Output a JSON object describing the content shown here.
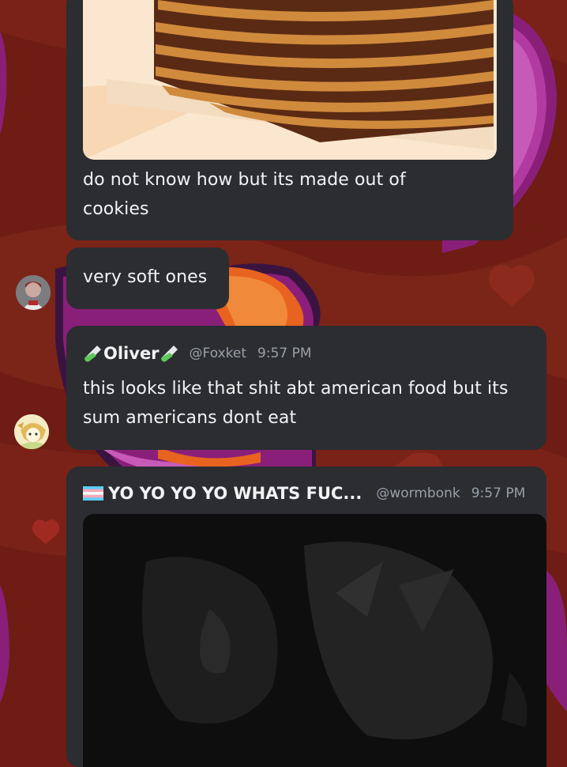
{
  "colors": {
    "background": "#6e1c14",
    "bubble": "#2b2d31",
    "accent_purple": "#8a1f7a",
    "accent_orange": "#e8631f",
    "text": "#f2f3f5",
    "muted": "#9aa0a8"
  },
  "messages": [
    {
      "text_lines": [
        "do not know how but its made out of",
        "cookies"
      ],
      "image_icon": "cookie-cake-image"
    },
    {
      "text": "very soft ones",
      "avatar_icon": "user-avatar-icon"
    },
    {
      "author": "Oliver",
      "author_icon": "test-tube-icon",
      "handle": "@Foxket",
      "time": "9:57 PM",
      "text_lines": [
        "this looks like that shit abt american food but its",
        "sum americans dont eat"
      ],
      "avatar_icon": "oliver-avatar-icon"
    },
    {
      "author": "YO YO YO YO WHATS FUC...",
      "author_icon": "trans-flag-icon",
      "handle": "@wormbonk",
      "time": "9:57 PM",
      "media_icon": "dark-video-thumbnail"
    }
  ]
}
